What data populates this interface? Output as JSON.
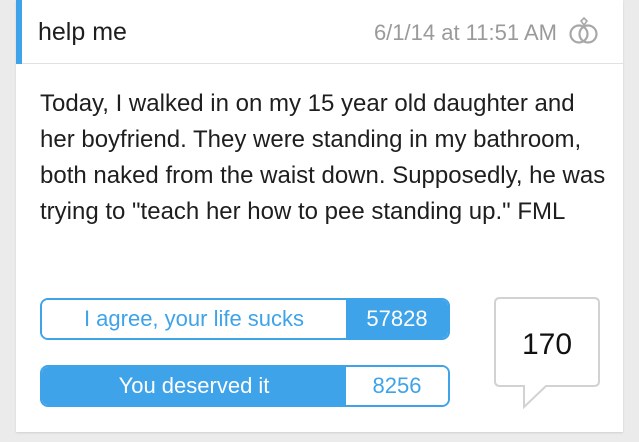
{
  "post": {
    "title": "help me",
    "timestamp": "6/1/14 at 11:51 AM",
    "category_icon": "wedding-rings-icon",
    "story": "Today, I walked in on my 15 year old daughter and her boyfriend. They were standing in my bathroom, both naked from the waist down. Supposedly, he was trying to \"teach her how to pee standing up.\" FML"
  },
  "votes": {
    "agree_label": "I agree, your life sucks",
    "agree_count": "57828",
    "deserved_label": "You deserved it",
    "deserved_count": "8256"
  },
  "comments": {
    "count": "170",
    "icon": "speech-bubble-icon"
  },
  "colors": {
    "accent": "#3ea3e8",
    "text": "#1e1e1e",
    "muted": "#9a9a9a",
    "background": "#ebebeb"
  }
}
